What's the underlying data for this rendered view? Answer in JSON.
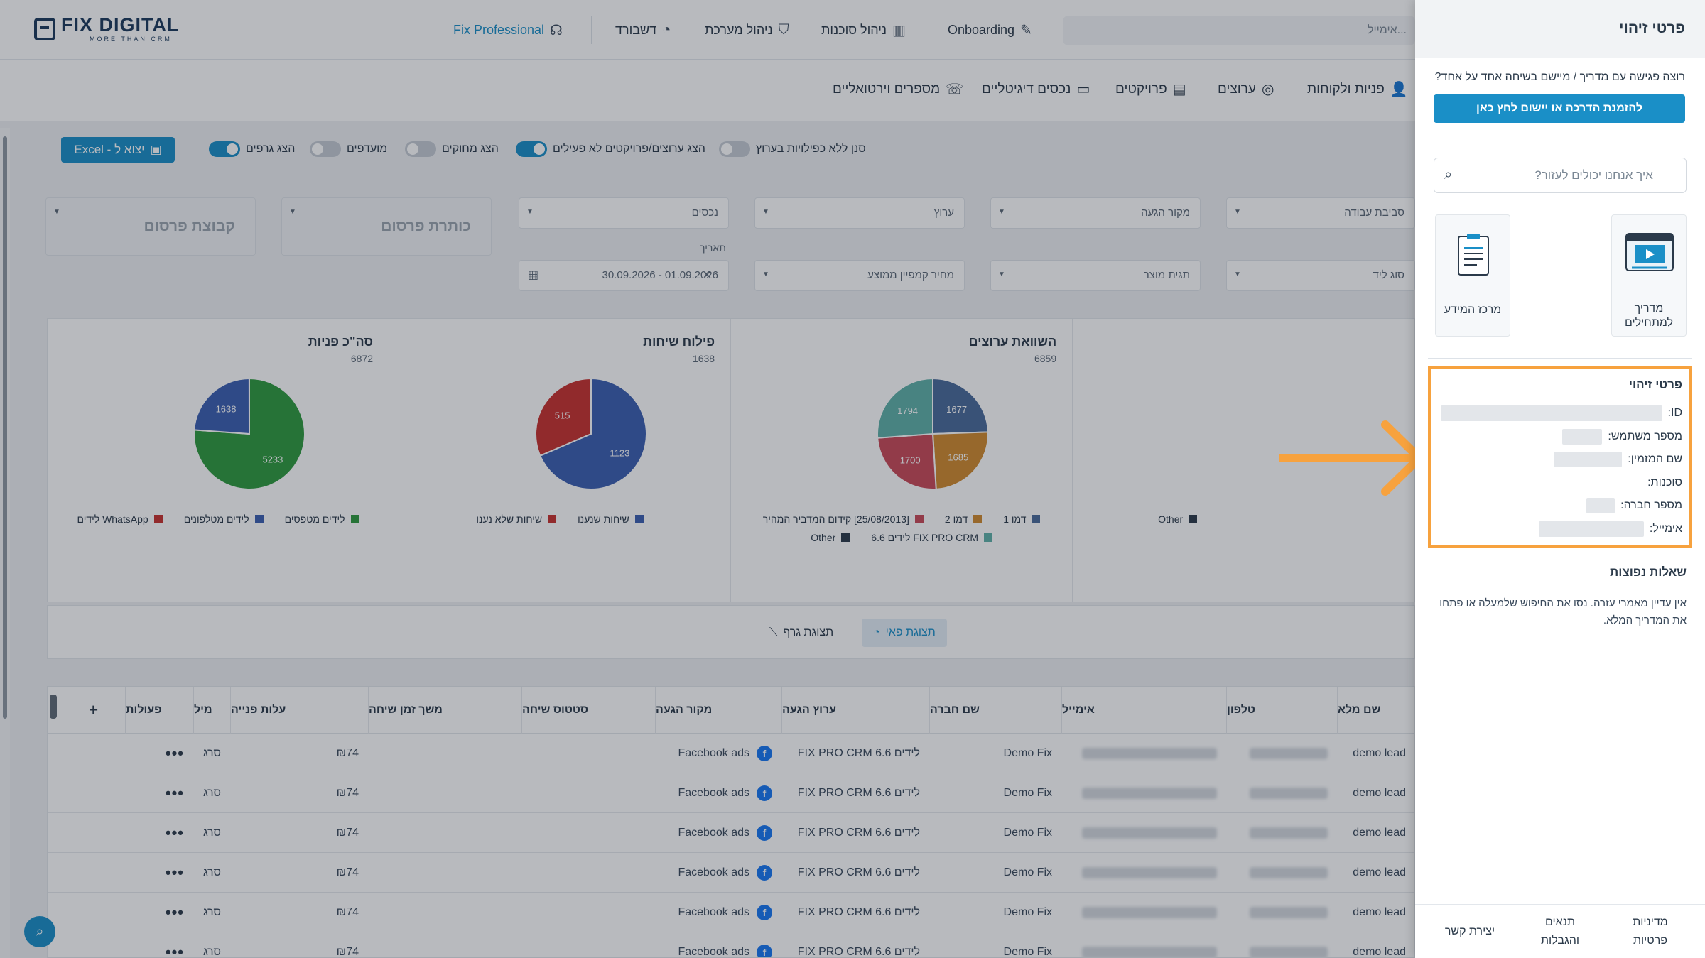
{
  "app": {
    "logo_main": "FIX DIGITAL",
    "logo_sub": "MORE THAN CRM",
    "search_placeholder": "...אימייל",
    "nav": {
      "professional": "Fix Professional",
      "reports": "דשבורד",
      "system": "ניהול מערכת",
      "agents": "ניהול סוכנות",
      "onboarding": "Onboarding"
    },
    "subnav": {
      "leads": "פניות ולקוחות",
      "channels": "ערוצים",
      "projects": "פרויקטים",
      "assets": "נכסים דיגיטליים",
      "virtual": "מספרים וירטואליים"
    }
  },
  "controls": {
    "export": "Excel - יצוא ל",
    "toggles": [
      {
        "label": "סנן ללא כפילויות בערוץ",
        "on": false
      },
      {
        "label": "הצג ערוצים/פרויקטים לא פעילים",
        "on": true
      },
      {
        "label": "הצג מחוקים",
        "on": false
      },
      {
        "label": "מועדפים",
        "on": false
      },
      {
        "label": "הצג גרפים",
        "on": true
      }
    ],
    "filters_row1": [
      "סביבת עבודה",
      "מקור הגעה",
      "ערוץ",
      "נכסים",
      "כותרת פרסום",
      "קבוצת פרסום"
    ],
    "filters_row2": [
      "סוג ליד",
      "תגית מוצר",
      "מחיר קמפיין ממוצע"
    ],
    "date_label": "תאריך",
    "date_value": "01.09.2026 - 30.09.2026"
  },
  "charts": [
    {
      "title": "סה\"כ פניות",
      "total": "6872",
      "legend": [
        {
          "label": "לידים מטפסים",
          "color": "#2f9a3e"
        },
        {
          "label": "לידים מטלפונים",
          "color": "#3b5fb0"
        },
        {
          "label": "WhatsApp לידים",
          "color": "#c8322e"
        }
      ]
    },
    {
      "title": "פילוח שיחות",
      "total": "1638",
      "legend": [
        {
          "label": "שיחות שנענו",
          "color": "#3b5fb0"
        },
        {
          "label": "שיחות שלא נענו",
          "color": "#c8322e"
        }
      ]
    },
    {
      "title": "השוואת ערוצים",
      "total": "6859",
      "legend": [
        {
          "label": "דמו 1",
          "color": "#4a6a9a"
        },
        {
          "label": "דמו 2",
          "color": "#d08a2e"
        },
        {
          "label": "[25/08/2013] קידום המדביר המהיר",
          "color": "#c94a58"
        },
        {
          "label": "FIX PRO CRM לידים 6.6",
          "color": "#5fb0a8"
        },
        {
          "label": "Other",
          "color": "#2b3a4a"
        }
      ]
    },
    {
      "title": "",
      "total": "",
      "legend": [
        {
          "label": "Other",
          "color": "#2b3a4a"
        }
      ]
    }
  ],
  "chart_data": [
    {
      "type": "pie",
      "title": "סה\"כ פניות",
      "categories": [
        "לידים מטפסים",
        "לידים מטלפונים",
        "WhatsApp לידים"
      ],
      "values": [
        5233,
        1638,
        1
      ]
    },
    {
      "type": "pie",
      "title": "פילוח שיחות",
      "categories": [
        "שיחות שנענו",
        "שיחות שלא נענו"
      ],
      "values": [
        1123,
        515
      ]
    },
    {
      "type": "pie",
      "title": "השוואת ערוצים",
      "categories": [
        "דמו 1",
        "דמו 2",
        "[25/08/2013] קידום המדביר המהיר",
        "FIX PRO CRM לידים 6.6"
      ],
      "values": [
        1677,
        1685,
        1700,
        1794
      ]
    }
  ],
  "viewbar": {
    "pie": "תצוגת פאי",
    "graph": "תצוגת גרף"
  },
  "table": {
    "headers": [
      "שם מלא",
      "טלפון",
      "אימייל",
      "שם חברה",
      "ערוץ הגעה",
      "מקור הגעה",
      "סטטוס שיחה",
      "משך זמן שיחה",
      "עלות פנייה",
      "מיל",
      "פעולות",
      "+"
    ],
    "rows": [
      {
        "name": "demo lead",
        "company": "Demo Fix",
        "channel": "FIX PRO CRM לידים 6.6",
        "source": "Facebook ads",
        "cost": "₪74",
        "agent": "סרג",
        "actions": "•••"
      },
      {
        "name": "demo lead",
        "company": "Demo Fix",
        "channel": "FIX PRO CRM לידים 6.6",
        "source": "Facebook ads",
        "cost": "₪74",
        "agent": "סרג",
        "actions": "•••"
      },
      {
        "name": "demo lead",
        "company": "Demo Fix",
        "channel": "FIX PRO CRM לידים 6.6",
        "source": "Facebook ads",
        "cost": "₪74",
        "agent": "סרג",
        "actions": "•••"
      },
      {
        "name": "demo lead",
        "company": "Demo Fix",
        "channel": "FIX PRO CRM לידים 6.6",
        "source": "Facebook ads",
        "cost": "₪74",
        "agent": "סרג",
        "actions": "•••"
      },
      {
        "name": "demo lead",
        "company": "Demo Fix",
        "channel": "FIX PRO CRM לידים 6.6",
        "source": "Facebook ads",
        "cost": "₪74",
        "agent": "סרג",
        "actions": "•••"
      },
      {
        "name": "demo lead",
        "company": "Demo Fix",
        "channel": "FIX PRO CRM לידים 6.6",
        "source": "Facebook ads",
        "cost": "₪74",
        "agent": "סרג",
        "actions": "•••"
      }
    ]
  },
  "panel": {
    "title": "פרטי זיהוי",
    "intro": "רוצה פגישה עם מדריך / מיישם בשיחה אחד על אחד?",
    "cta": "להזמנת הדרכה או יישום לחץ כאן",
    "search_placeholder": "איך אנחנו יכולים לעזור?",
    "cards": [
      {
        "label": "מדריך למתחילים"
      },
      {
        "label": "מרכז המידע"
      }
    ],
    "id_title": "פרטי זיהוי",
    "id_fields": [
      {
        "label": "ID:"
      },
      {
        "label": "מספר משתמש:"
      },
      {
        "label": "שם המזמין:"
      },
      {
        "label": "סוכנות:"
      },
      {
        "label": "מספר חברה:"
      },
      {
        "label": "אימייל:"
      }
    ],
    "faq_title": "שאלות נפוצות",
    "faq_desc": "אין עדיין מאמרי עזרה. נסו את החיפוש שלמעלה או פתחו את המדריך המלא.",
    "footer": [
      "מדיניות פרטיות",
      "תנאים והגבלות",
      "יצירת קשר"
    ]
  },
  "colors": {
    "accent": "#1a8fc7",
    "highlight": "#f7a23e"
  }
}
